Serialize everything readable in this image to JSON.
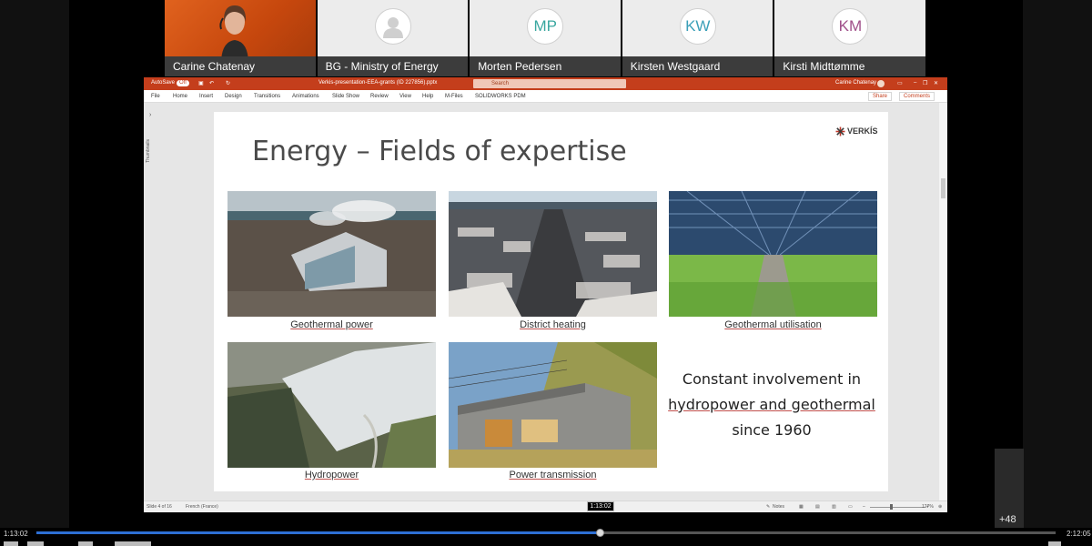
{
  "meeting": {
    "participants": [
      {
        "name": "Carine Chatenay",
        "initials": "",
        "has_video": true
      },
      {
        "name": "BG - Ministry of Energy",
        "initials": "",
        "has_video": false
      },
      {
        "name": "Morten Pedersen",
        "initials": "MP",
        "has_video": false,
        "color": "#3aa7a0"
      },
      {
        "name": "Kirsten Westgaard",
        "initials": "KW",
        "has_video": false,
        "color": "#3a9fb8"
      },
      {
        "name": "Kirsti Midttømme",
        "initials": "KM",
        "has_video": false,
        "color": "#a0508a"
      }
    ],
    "more_participants": "+48"
  },
  "powerpoint": {
    "autosave_label": "AutoSave",
    "autosave_state": "Off",
    "file_name": "Verkis-presentation-EEA-grants (ID 227856).pptx",
    "search_placeholder": "Search",
    "user_name": "Carine Chatenay",
    "menu": [
      "File",
      "Home",
      "Insert",
      "Design",
      "Transitions",
      "Animations",
      "Slide Show",
      "Review",
      "View",
      "Help",
      "M-Files",
      "SOLIDWORKS PDM"
    ],
    "share_label": "Share",
    "comments_label": "Comments",
    "thumbnails_label": "Thumbnails",
    "status": {
      "slide_counter": "Slide 4 of 16",
      "language": "French (France)",
      "notes_label": "Notes",
      "zoom": "127%"
    }
  },
  "slide": {
    "title": "Energy – Fields of expertise",
    "logo_text": "VERKÍS",
    "items": [
      {
        "caption": "Geothermal power"
      },
      {
        "caption": "District heating"
      },
      {
        "caption": "Geothermal utilisation"
      },
      {
        "caption": "Hydropower"
      },
      {
        "caption": "Power transmission"
      }
    ],
    "note_line1": "Constant involvement in",
    "note_line2": "hydropower and geothermal",
    "note_line3": "since 1960"
  },
  "player": {
    "current_time": "1:13:02",
    "total_time": "2:12:05",
    "tooltip_time": "1:13:02",
    "progress_fraction": 0.553
  }
}
